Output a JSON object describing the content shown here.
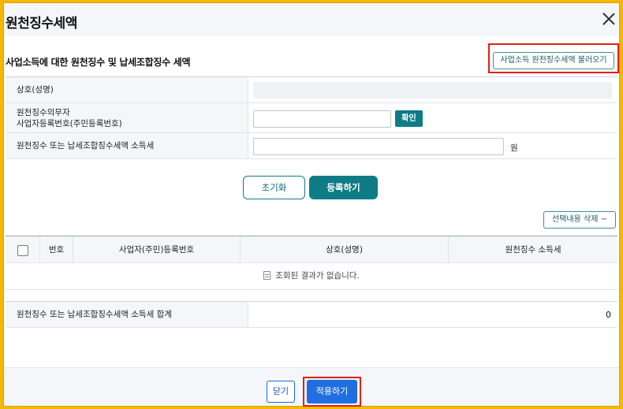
{
  "dialog": {
    "title": "원천징수세액",
    "close_icon": "close-icon"
  },
  "section": {
    "title": "사업소득에 대한 원천징수 및 납세조합징수 세액",
    "load_button": "사업소득 원천징수세액 불러오기"
  },
  "form": {
    "rows": [
      {
        "label": "상호(성명)"
      },
      {
        "label_line1": "원천징수의무자",
        "label_line2": "사업자등록번호(주민등록번호)",
        "input_value": "",
        "confirm_button": "확인"
      },
      {
        "label": "원천징수 또는 납세조합징수세액 소득세",
        "input_value": "",
        "unit": "원"
      }
    ]
  },
  "actions": {
    "reset_button": "초기화",
    "register_button": "등록하기",
    "delete_selected_button": "선택내용 삭제 −"
  },
  "grid": {
    "columns": [
      "번호",
      "사업자(주민)등록번호",
      "상호(성명)",
      "원천징수 소득세"
    ],
    "empty_message": "조회된 결과가 없습니다."
  },
  "summary": {
    "label": "원천징수 또는 납세조합징수세액 소득세 합계",
    "value": "0"
  },
  "footer": {
    "close_button": "닫기",
    "apply_button": "적용하기"
  },
  "colors": {
    "frame": "#f5b800",
    "primary": "#0e7c86",
    "apply": "#1f6fe0",
    "highlight": "#e0201a"
  }
}
